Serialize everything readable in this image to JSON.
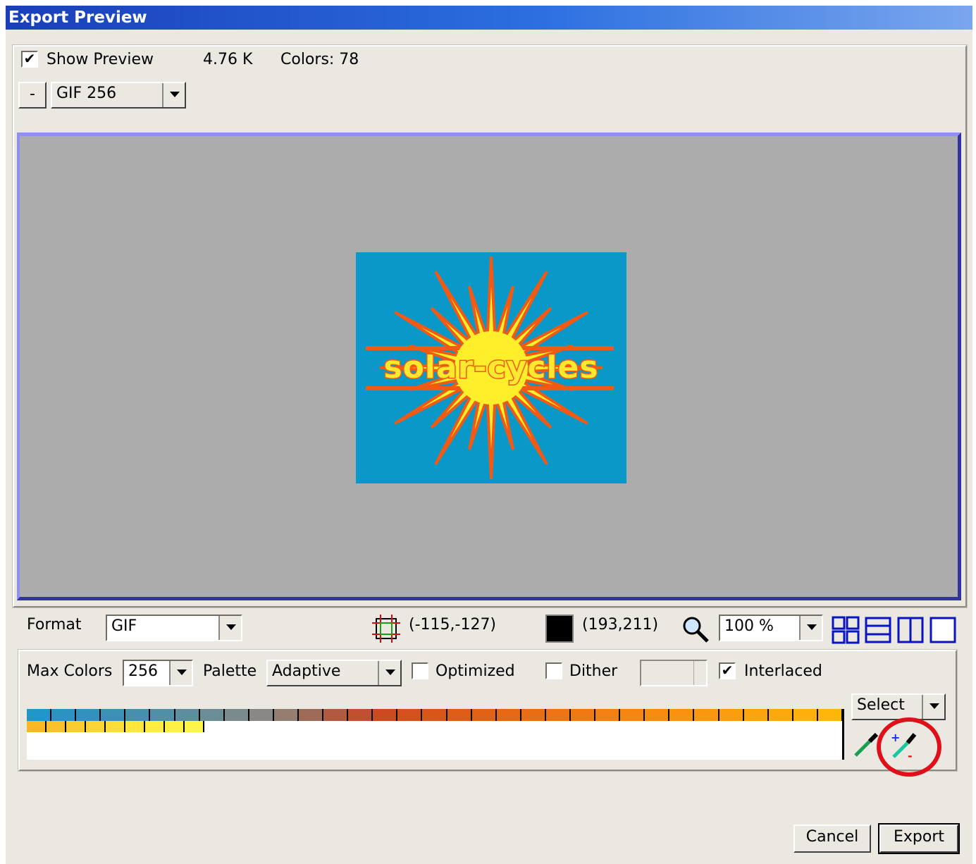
{
  "window": {
    "title": "Export Preview"
  },
  "top": {
    "show_preview_label": "Show Preview",
    "show_preview_checked": true,
    "file_size": "4.76 K",
    "colors_label": "Colors: 78",
    "minus_label": "-",
    "preset_value": "GIF 256"
  },
  "preview": {
    "logo_text": "solar-cycles"
  },
  "format_row": {
    "format_label": "Format",
    "format_value": "GIF",
    "crop_coords": "(-115,-127)",
    "image_size": "(193,211)",
    "zoom_value": "100 %"
  },
  "options": {
    "max_colors_label": "Max Colors",
    "max_colors_value": "256",
    "palette_label": "Palette",
    "palette_value": "Adaptive",
    "optimized_label": "Optimized",
    "optimized_checked": false,
    "dither_label": "Dither",
    "dither_checked": false,
    "interlaced_label": "Interlaced",
    "interlaced_checked": true,
    "select_label": "Select"
  },
  "palette_colors_row1": [
    "#2196c8",
    "#2a93c0",
    "#3392bb",
    "#3a90b5",
    "#4790ad",
    "#4f8fa8",
    "#5d8ea0",
    "#6a8d97",
    "#7a8b8e",
    "#8a8886",
    "#957d70",
    "#a06a58",
    "#b05a40",
    "#c05030",
    "#cc4a22",
    "#d4501c",
    "#d8561a",
    "#dc5c18",
    "#e06217",
    "#e46816",
    "#e86e15",
    "#ec7414",
    "#ef7a13",
    "#f28012",
    "#f48611",
    "#f68c10",
    "#f8920f",
    "#f9980e",
    "#fa9e0d",
    "#fba40c",
    "#fcaa0b",
    "#fdb00a",
    "#feb709"
  ],
  "palette_colors_row2": [
    "#f7b824",
    "#f9c22a",
    "#fbcc2e",
    "#fdd532",
    "#fede36",
    "#ffe63a",
    "#ffec3e",
    "#fff142",
    "#fff546"
  ],
  "buttons": {
    "cancel": "Cancel",
    "export": "Export"
  },
  "colors": {
    "titlebar": "#1a3fb8",
    "preview_bg": "#acacac",
    "logo_bg": "#0a98c8",
    "highlight_circle": "#e0101a"
  }
}
